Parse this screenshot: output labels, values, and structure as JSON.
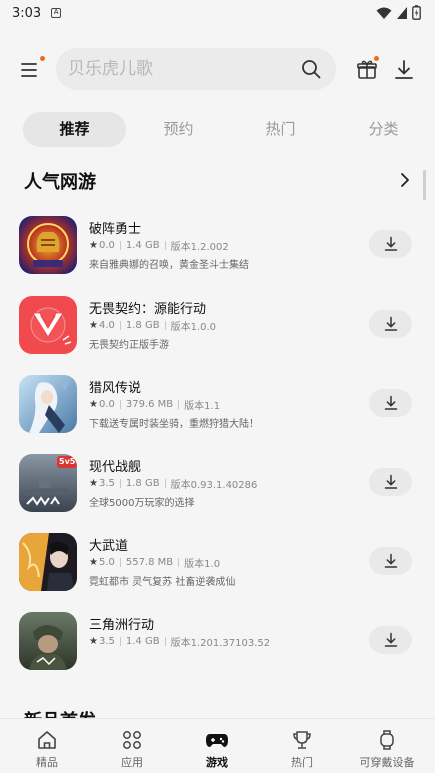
{
  "status": {
    "time": "3:03"
  },
  "search": {
    "placeholder": "贝乐虎儿歌"
  },
  "tabs": [
    {
      "label": "推荐",
      "active": true
    },
    {
      "label": "预约",
      "active": false
    },
    {
      "label": "热门",
      "active": false
    },
    {
      "label": "分类",
      "active": false
    }
  ],
  "section": {
    "title": "人气网游",
    "next_title": "新品首发"
  },
  "games": [
    {
      "name": "破阵勇士",
      "rating": "0.0",
      "size": "1.4 GB",
      "version": "版本1.2.002",
      "desc": "来自雅典娜的召唤，黄金圣斗士集结",
      "icon": "poze-icon"
    },
    {
      "name": "无畏契约：源能行动",
      "rating": "4.0",
      "size": "1.8 GB",
      "version": "版本1.0.0",
      "desc": "无畏契约正版手游",
      "icon": "valorant-icon"
    },
    {
      "name": "猎风传说",
      "rating": "0.0",
      "size": "379.6 MB",
      "version": "版本1.1",
      "desc": "下载送专属时装坐骑，重燃狩猎大陆！",
      "icon": "liefeng-icon"
    },
    {
      "name": "现代战舰",
      "rating": "3.5",
      "size": "1.8 GB",
      "version": "版本0.93.1.40286",
      "desc": "全球5000万玩家的选择",
      "icon": "modern-warships-icon",
      "badge": "5v5"
    },
    {
      "name": "大武道",
      "rating": "5.0",
      "size": "557.8 MB",
      "version": "版本1.0",
      "desc": "霓虹都市 灵气复苏 社畜逆袭成仙",
      "icon": "dawudao-icon"
    },
    {
      "name": "三角洲行动",
      "rating": "3.5",
      "size": "1.4 GB",
      "version": "版本1.201.37103.52",
      "desc": "",
      "icon": "delta-force-icon"
    }
  ],
  "bottom_nav": [
    {
      "label": "精品",
      "icon": "home-icon",
      "active": false
    },
    {
      "label": "应用",
      "icon": "apps-icon",
      "active": false
    },
    {
      "label": "游戏",
      "icon": "gamepad-icon",
      "active": true
    },
    {
      "label": "热门",
      "icon": "trophy-icon",
      "active": false
    },
    {
      "label": "可穿戴设备",
      "icon": "watch-icon",
      "active": false
    }
  ],
  "colors": {
    "accent_dot": "#f26b1d",
    "active_tab_bg": "#e6e6e6"
  }
}
